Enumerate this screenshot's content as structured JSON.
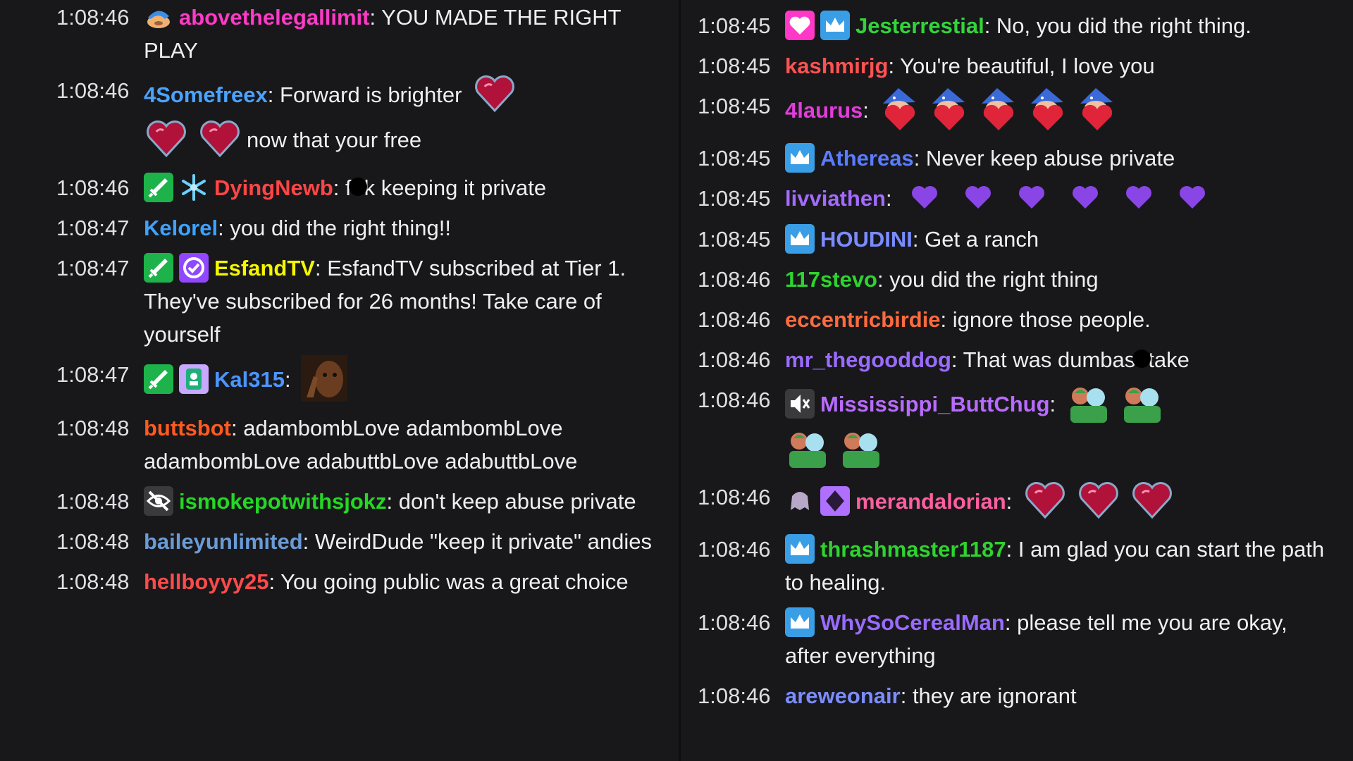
{
  "colors": {
    "bg": "#18181b",
    "abovethelegallimit": "#ff3ac7",
    "4Somefreex": "#4aa3ff",
    "DyingNewb": "#ff4545",
    "Kelorel": "#3ea2ff",
    "EsfandTV": "#f5f500",
    "Kal315": "#4a96ff",
    "buttsbot": "#ff5a1f",
    "ismokepotwithsjokz": "#24d824",
    "baileyunlimited": "#6b9bd6",
    "hellboyyy25": "#ff4a4a",
    "Jesterrestial": "#32d43a",
    "kashmirjg": "#ff5252",
    "4laurus": "#e23ddb",
    "Athereas": "#5b7cff",
    "livviathen": "#a36bff",
    "HOUDINI": "#7a8cff",
    "117stevo": "#2ed42e",
    "eccentricbirdie": "#ff6b3e",
    "mr_thegooddog": "#9a6bff",
    "Mississippi_ButtChug": "#b96bff",
    "merandalorian": "#ff5fa0",
    "thrashmaster1187": "#2ed42e",
    "WhySoCerealMan": "#9a6bff",
    "areweonair": "#7a8cff"
  },
  "left": [
    {
      "time": "1:08:46",
      "user": "abovethelegallimit",
      "badges": [
        "cap-badge-icon"
      ],
      "text": "YOU MADE THE RIGHT PLAY"
    },
    {
      "time": "1:08:46",
      "user": "4Somefreex",
      "text1": "Forward is brighter",
      "emotes": [
        "heart-emote-icon",
        "heart-emote-icon",
        "heart-emote-icon"
      ],
      "text2": "now that your free"
    },
    {
      "time": "1:08:46",
      "user": "DyingNewb",
      "badges": [
        "sword-badge-icon",
        "snowflake-badge-icon"
      ],
      "text1": "f",
      "text2": "k keeping it private"
    },
    {
      "time": "1:08:47",
      "user": "Kelorel",
      "text": "you did the right thing!!"
    },
    {
      "time": "1:08:47",
      "user": "EsfandTV",
      "badges": [
        "sword-badge-icon",
        "verified-badge-icon"
      ],
      "text": "EsfandTV subscribed at Tier 1. They've subscribed for 26 months! Take care of yourself"
    },
    {
      "time": "1:08:47",
      "user": "Kal315",
      "badges": [
        "sword-badge-icon",
        "sub-badge-icon"
      ],
      "emotes": [
        "thinking-face-emote-icon"
      ]
    },
    {
      "time": "1:08:48",
      "user": "buttsbot",
      "text": "adambombLove adambombLove adambombLove adabuttbLove adabuttbLove"
    },
    {
      "time": "1:08:48",
      "user": "ismokepotwithsjokz",
      "badges": [
        "no-audio-badge-icon"
      ],
      "text": "don't keep abuse private"
    },
    {
      "time": "1:08:48",
      "user": "baileyunlimited",
      "text": "WeirdDude \"keep it private\" andies"
    },
    {
      "time": "1:08:48",
      "user": "hellboyyy25",
      "text": "You going public was a great choice"
    }
  ],
  "right": [
    {
      "time": "1:08:45",
      "user": "Jesterrestial",
      "badges": [
        "heart-badge-icon",
        "crown-badge-icon"
      ],
      "text": "No, you did the right thing."
    },
    {
      "time": "1:08:45",
      "user": "kashmirjg",
      "text": "You're beautiful, I love you"
    },
    {
      "time": "1:08:45",
      "user": "4laurus",
      "emotes": [
        "wizard-heart-emote-icon",
        "wizard-heart-emote-icon",
        "wizard-heart-emote-icon",
        "wizard-heart-emote-icon",
        "wizard-heart-emote-icon"
      ]
    },
    {
      "time": "1:08:45",
      "user": "Athereas",
      "badges": [
        "crown-badge-icon"
      ],
      "text": "Never keep abuse private"
    },
    {
      "time": "1:08:45",
      "user": "livviathen",
      "emotes": [
        "purple-heart-icon",
        "purple-heart-icon",
        "purple-heart-icon",
        "purple-heart-icon",
        "purple-heart-icon",
        "purple-heart-icon"
      ]
    },
    {
      "time": "1:08:45",
      "user": "HOUDINI",
      "badges": [
        "crown-badge-icon"
      ],
      "text": "Get a ranch"
    },
    {
      "time": "1:08:46",
      "user": "117stevo",
      "text": "you did the right thing"
    },
    {
      "time": "1:08:46",
      "user": "eccentricbirdie",
      "text": "ignore those people."
    },
    {
      "time": "1:08:46",
      "user": "mr_thegooddog",
      "text1": "That was dumbas",
      "text2": "take"
    },
    {
      "time": "1:08:46",
      "user": "Mississippi_ButtChug",
      "badges": [
        "mute-badge-icon"
      ],
      "emotes": [
        "hug-emote-icon",
        "hug-emote-icon",
        "hug-emote-icon",
        "hug-emote-icon"
      ]
    },
    {
      "time": "1:08:46",
      "user": "merandalorian",
      "badges": [
        "ghost-badge-icon",
        "gem-badge-icon"
      ],
      "emotes": [
        "heart-emote-icon",
        "heart-emote-icon",
        "heart-emote-icon"
      ]
    },
    {
      "time": "1:08:46",
      "user": "thrashmaster1187",
      "badges": [
        "crown-badge-icon"
      ],
      "text": "I am glad you can start the path to healing."
    },
    {
      "time": "1:08:46",
      "user": "WhySoCerealMan",
      "badges": [
        "crown-badge-icon"
      ],
      "text": "please tell me you are okay, after everything"
    },
    {
      "time": "1:08:46",
      "user": "areweonair",
      "text": "they are ignorant"
    }
  ]
}
